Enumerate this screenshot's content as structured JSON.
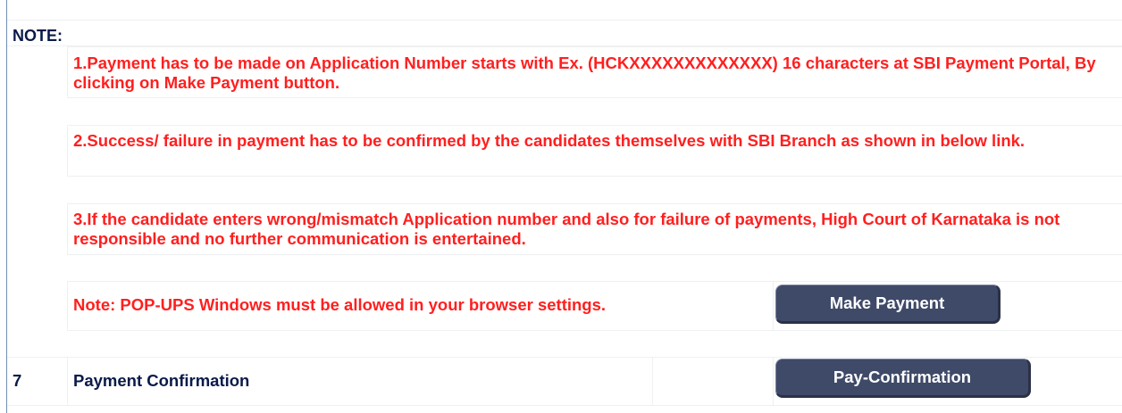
{
  "note": {
    "heading": "NOTE:",
    "points": [
      "1.Payment has to be made on Application Number starts with Ex. (HCKXXXXXXXXXXXXX) 16 characters at SBI Payment Portal, By clicking on Make Payment button.",
      "2.Success/ failure in payment has to be confirmed by the candidates themselves with SBI Branch as shown in below link.",
      "3.If the candidate enters wrong/mismatch Application number and also for failure of payments, High Court of Karnataka is not responsible and no further communication is entertained."
    ],
    "popup_warning": "Note: POP-UPS Windows must be allowed in your browser settings.",
    "make_payment_label": "Make Payment"
  },
  "confirmation_row": {
    "number": "7",
    "title": "Payment Confirmation",
    "button_label": "Pay-Confirmation"
  },
  "colors": {
    "note_red": "#ff1f1f",
    "heading_navy": "#0a1a4a",
    "button_bg": "#3f4a68"
  }
}
